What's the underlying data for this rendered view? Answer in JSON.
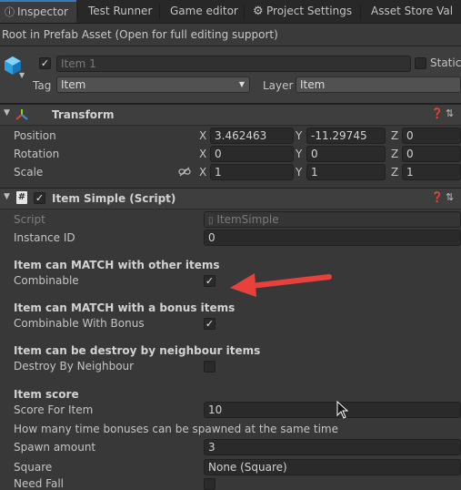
{
  "tabs": [
    {
      "label": "Inspector"
    },
    {
      "label": "Test Runner"
    },
    {
      "label": "Game editor"
    },
    {
      "label": "Project Settings"
    },
    {
      "label": "Asset Store Val"
    }
  ],
  "banner": "Root in Prefab Asset (Open for full editing support)",
  "header": {
    "name_value": "Item 1",
    "static_label": "Static",
    "tag_label": "Tag",
    "tag_value": "Item",
    "layer_label": "Layer",
    "layer_value": "Item"
  },
  "transform": {
    "title": "Transform",
    "rows": [
      {
        "label": "Position",
        "x": "3.462463",
        "y": "-11.29745",
        "z": "0"
      },
      {
        "label": "Rotation",
        "x": "0",
        "y": "0",
        "z": "0"
      },
      {
        "label": "Scale",
        "x": "1",
        "y": "1",
        "z": "1"
      }
    ],
    "axis": {
      "x": "X",
      "y": "Y",
      "z": "Z"
    }
  },
  "script_component": {
    "title": "Item Simple (Script)",
    "script_label": "Script",
    "script_value": "ItemSimple",
    "instance_label": "Instance ID",
    "instance_value": "0",
    "match_heading": "Item can MATCH with other items",
    "combinable_label": "Combinable",
    "combinable_checked": true,
    "bonus_heading": "Item can MATCH with a bonus items",
    "combinable_bonus_label": "Combinable With Bonus",
    "combinable_bonus_checked": true,
    "destroy_heading": "Item can be destroy by neighbour items",
    "destroy_label": "Destroy By Neighbour",
    "destroy_checked": false,
    "score_heading": "Item score",
    "score_label": "Score For Item",
    "score_value": "10",
    "bonus_note": "How many time bonuses can be spawned at the same time",
    "spawn_label": "Spawn amount",
    "spawn_value": "3",
    "square_label": "Square",
    "square_value": "None (Square)",
    "needfall_label": "Need Fall"
  },
  "colors": {
    "accent_tab": "#3a79bb",
    "arrow": "#e8413c",
    "panel_bg": "#383838"
  },
  "icons": [
    "settings-gear-icon",
    "cube-icon",
    "transform-axes-icon",
    "help-icon",
    "preset-icon",
    "kebab-menu-icon",
    "script-hash-icon",
    "constrain-link-icon",
    "object-picker-icon",
    "mouse-cursor-icon"
  ]
}
